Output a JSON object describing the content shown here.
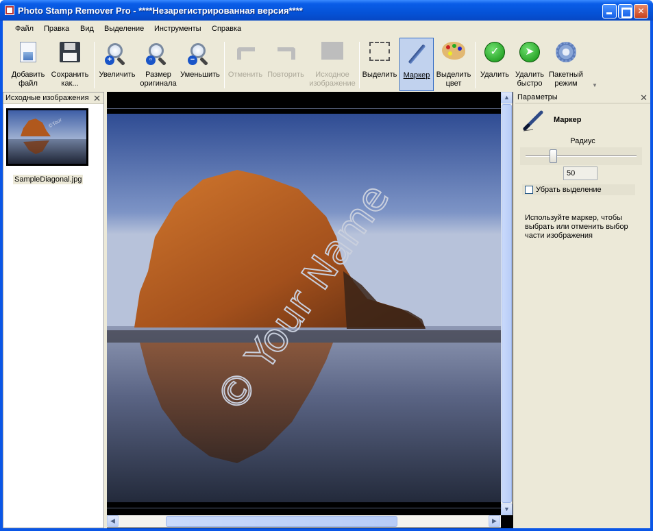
{
  "window": {
    "title": "Photo Stamp Remover Pro - ****Незарегистрированная версия****"
  },
  "menu": [
    "Файл",
    "Правка",
    "Вид",
    "Выделение",
    "Инструменты",
    "Справка"
  ],
  "toolbar": {
    "add": "Добавить\nфайл",
    "save": "Сохранить\nкак...",
    "zoom_in": "Увеличить",
    "original": "Размер\nоригинала",
    "zoom_out": "Уменьшить",
    "undo": "Отменить",
    "redo": "Повторить",
    "source": "Исходное\nизображение",
    "select": "Выделить",
    "marker": "Маркер",
    "color_select": "Выделить\nцвет",
    "remove": "Удалить",
    "remove_fast": "Удалить\nбыстро",
    "batch": "Пакетный\nрежим"
  },
  "left_panel": {
    "title": "Исходные изображения",
    "file_name": "SampleDiagonal.jpg"
  },
  "watermark_text": "© Your Name",
  "right_panel": {
    "title": "Параметры",
    "tool_name": "Маркер",
    "radius_label": "Радиус",
    "radius_value": "50",
    "checkbox_label": "Убрать выделение",
    "help_text": "Используйте маркер, чтобы выбрать или отменить выбор части изображения"
  }
}
